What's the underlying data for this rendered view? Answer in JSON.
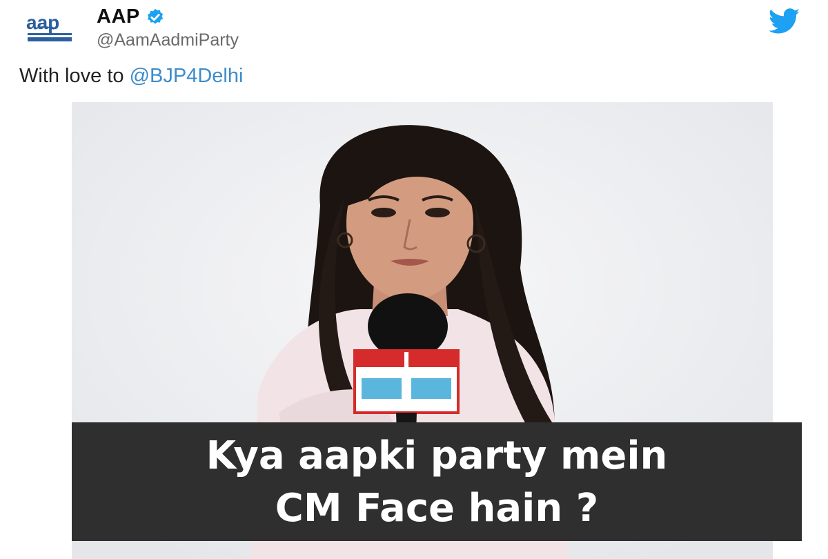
{
  "account": {
    "display_name": "AAP",
    "handle": "@AamAadmiParty",
    "avatar_logo": "aap",
    "verified_icon": "verified-badge-icon",
    "platform_icon": "twitter-bird-icon"
  },
  "tweet": {
    "text_prefix": "With love to ",
    "mention": "@BJP4Delhi"
  },
  "media": {
    "caption_line1": "Kya aapki party mein",
    "caption_line2": "CM Face hain ?"
  },
  "colors": {
    "mention": "#3d8ccb",
    "verified": "#1da1f2",
    "twitter_blue": "#1da1f2",
    "caption_bg": "#2f2f2f",
    "logo_blue": "#2c5f9e"
  }
}
